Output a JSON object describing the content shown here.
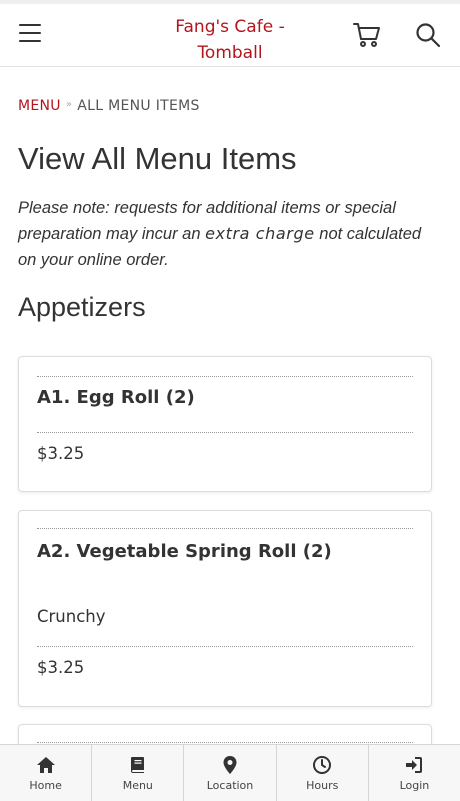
{
  "header": {
    "title_line1": "Fang's Cafe -",
    "title_line2": "Tomball",
    "icons": [
      "menu-icon",
      "cart-icon",
      "search-icon"
    ]
  },
  "breadcrumb": {
    "parent": "MENU",
    "current": "ALL MENU ITEMS"
  },
  "page_title": "View All Menu Items",
  "note": {
    "before": "Please note: requests for additional items or special preparation may incur an ",
    "emphasis": "extra charge",
    "after": " not calculated on your online order."
  },
  "section": {
    "title": "Appetizers",
    "items": [
      {
        "name": "A1. Egg Roll (2)",
        "description": "",
        "price": "$3.25"
      },
      {
        "name": "A2. Vegetable Spring Roll (2)",
        "description": "Crunchy",
        "price": "$3.25"
      }
    ]
  },
  "bottom_nav": [
    {
      "label": "Home",
      "icon": "home-icon"
    },
    {
      "label": "Menu",
      "icon": "book-icon"
    },
    {
      "label": "Location",
      "icon": "map-pin-icon"
    },
    {
      "label": "Hours",
      "icon": "clock-icon"
    },
    {
      "label": "Login",
      "icon": "login-icon"
    }
  ],
  "colors": {
    "accent": "#b3151d",
    "text": "#333333"
  }
}
